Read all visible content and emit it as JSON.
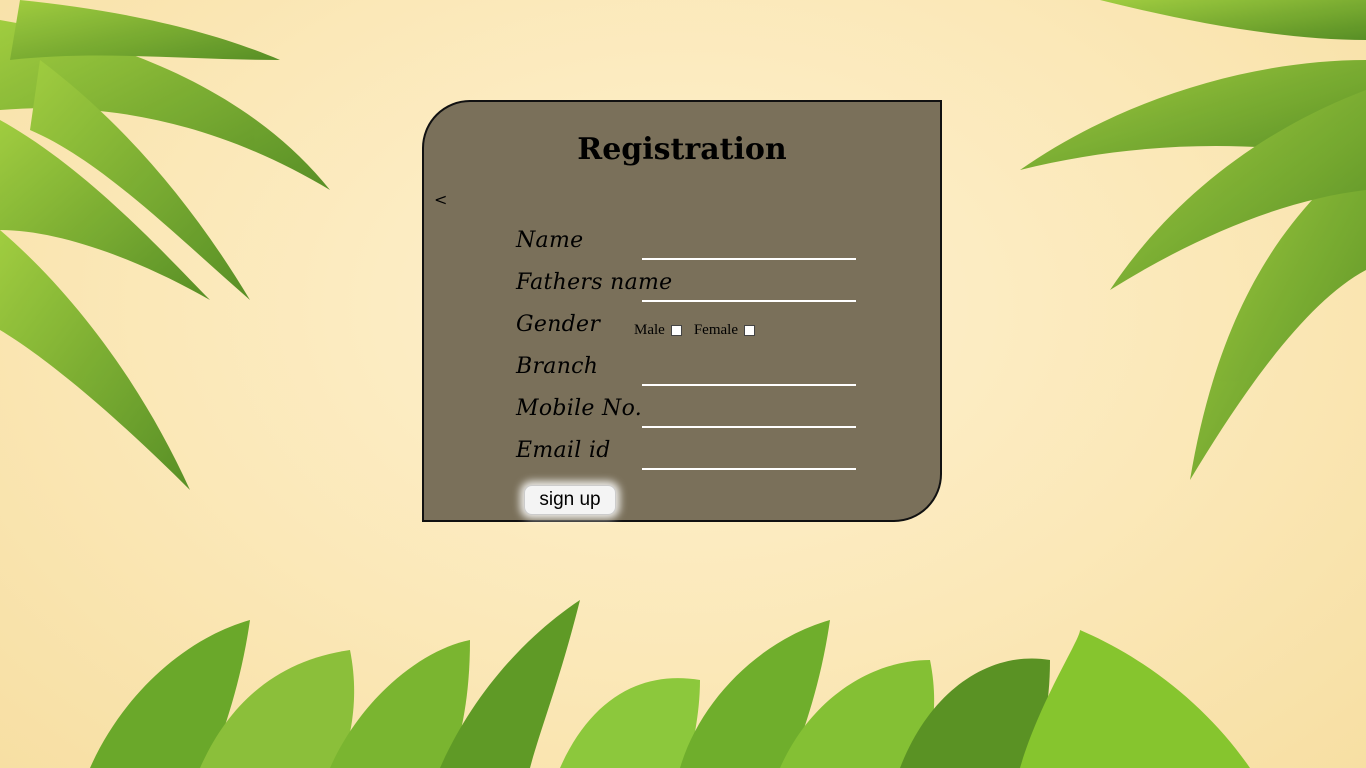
{
  "form": {
    "title": "Registration",
    "back_label": "<",
    "fields": {
      "name": {
        "label": "Name",
        "value": ""
      },
      "fathers_name": {
        "label": "Fathers name",
        "value": ""
      },
      "gender": {
        "label": "Gender",
        "options": [
          "Male",
          "Female"
        ]
      },
      "branch": {
        "label": "Branch",
        "value": ""
      },
      "mobile": {
        "label": "Mobile No.",
        "value": ""
      },
      "email": {
        "label": "Email id",
        "value": ""
      }
    },
    "submit_label": "sign up"
  },
  "colors": {
    "background": "#fbe8b8",
    "card": "#7a705a",
    "leaf_green": "#7bb22d",
    "field_line": "#ffffff"
  }
}
